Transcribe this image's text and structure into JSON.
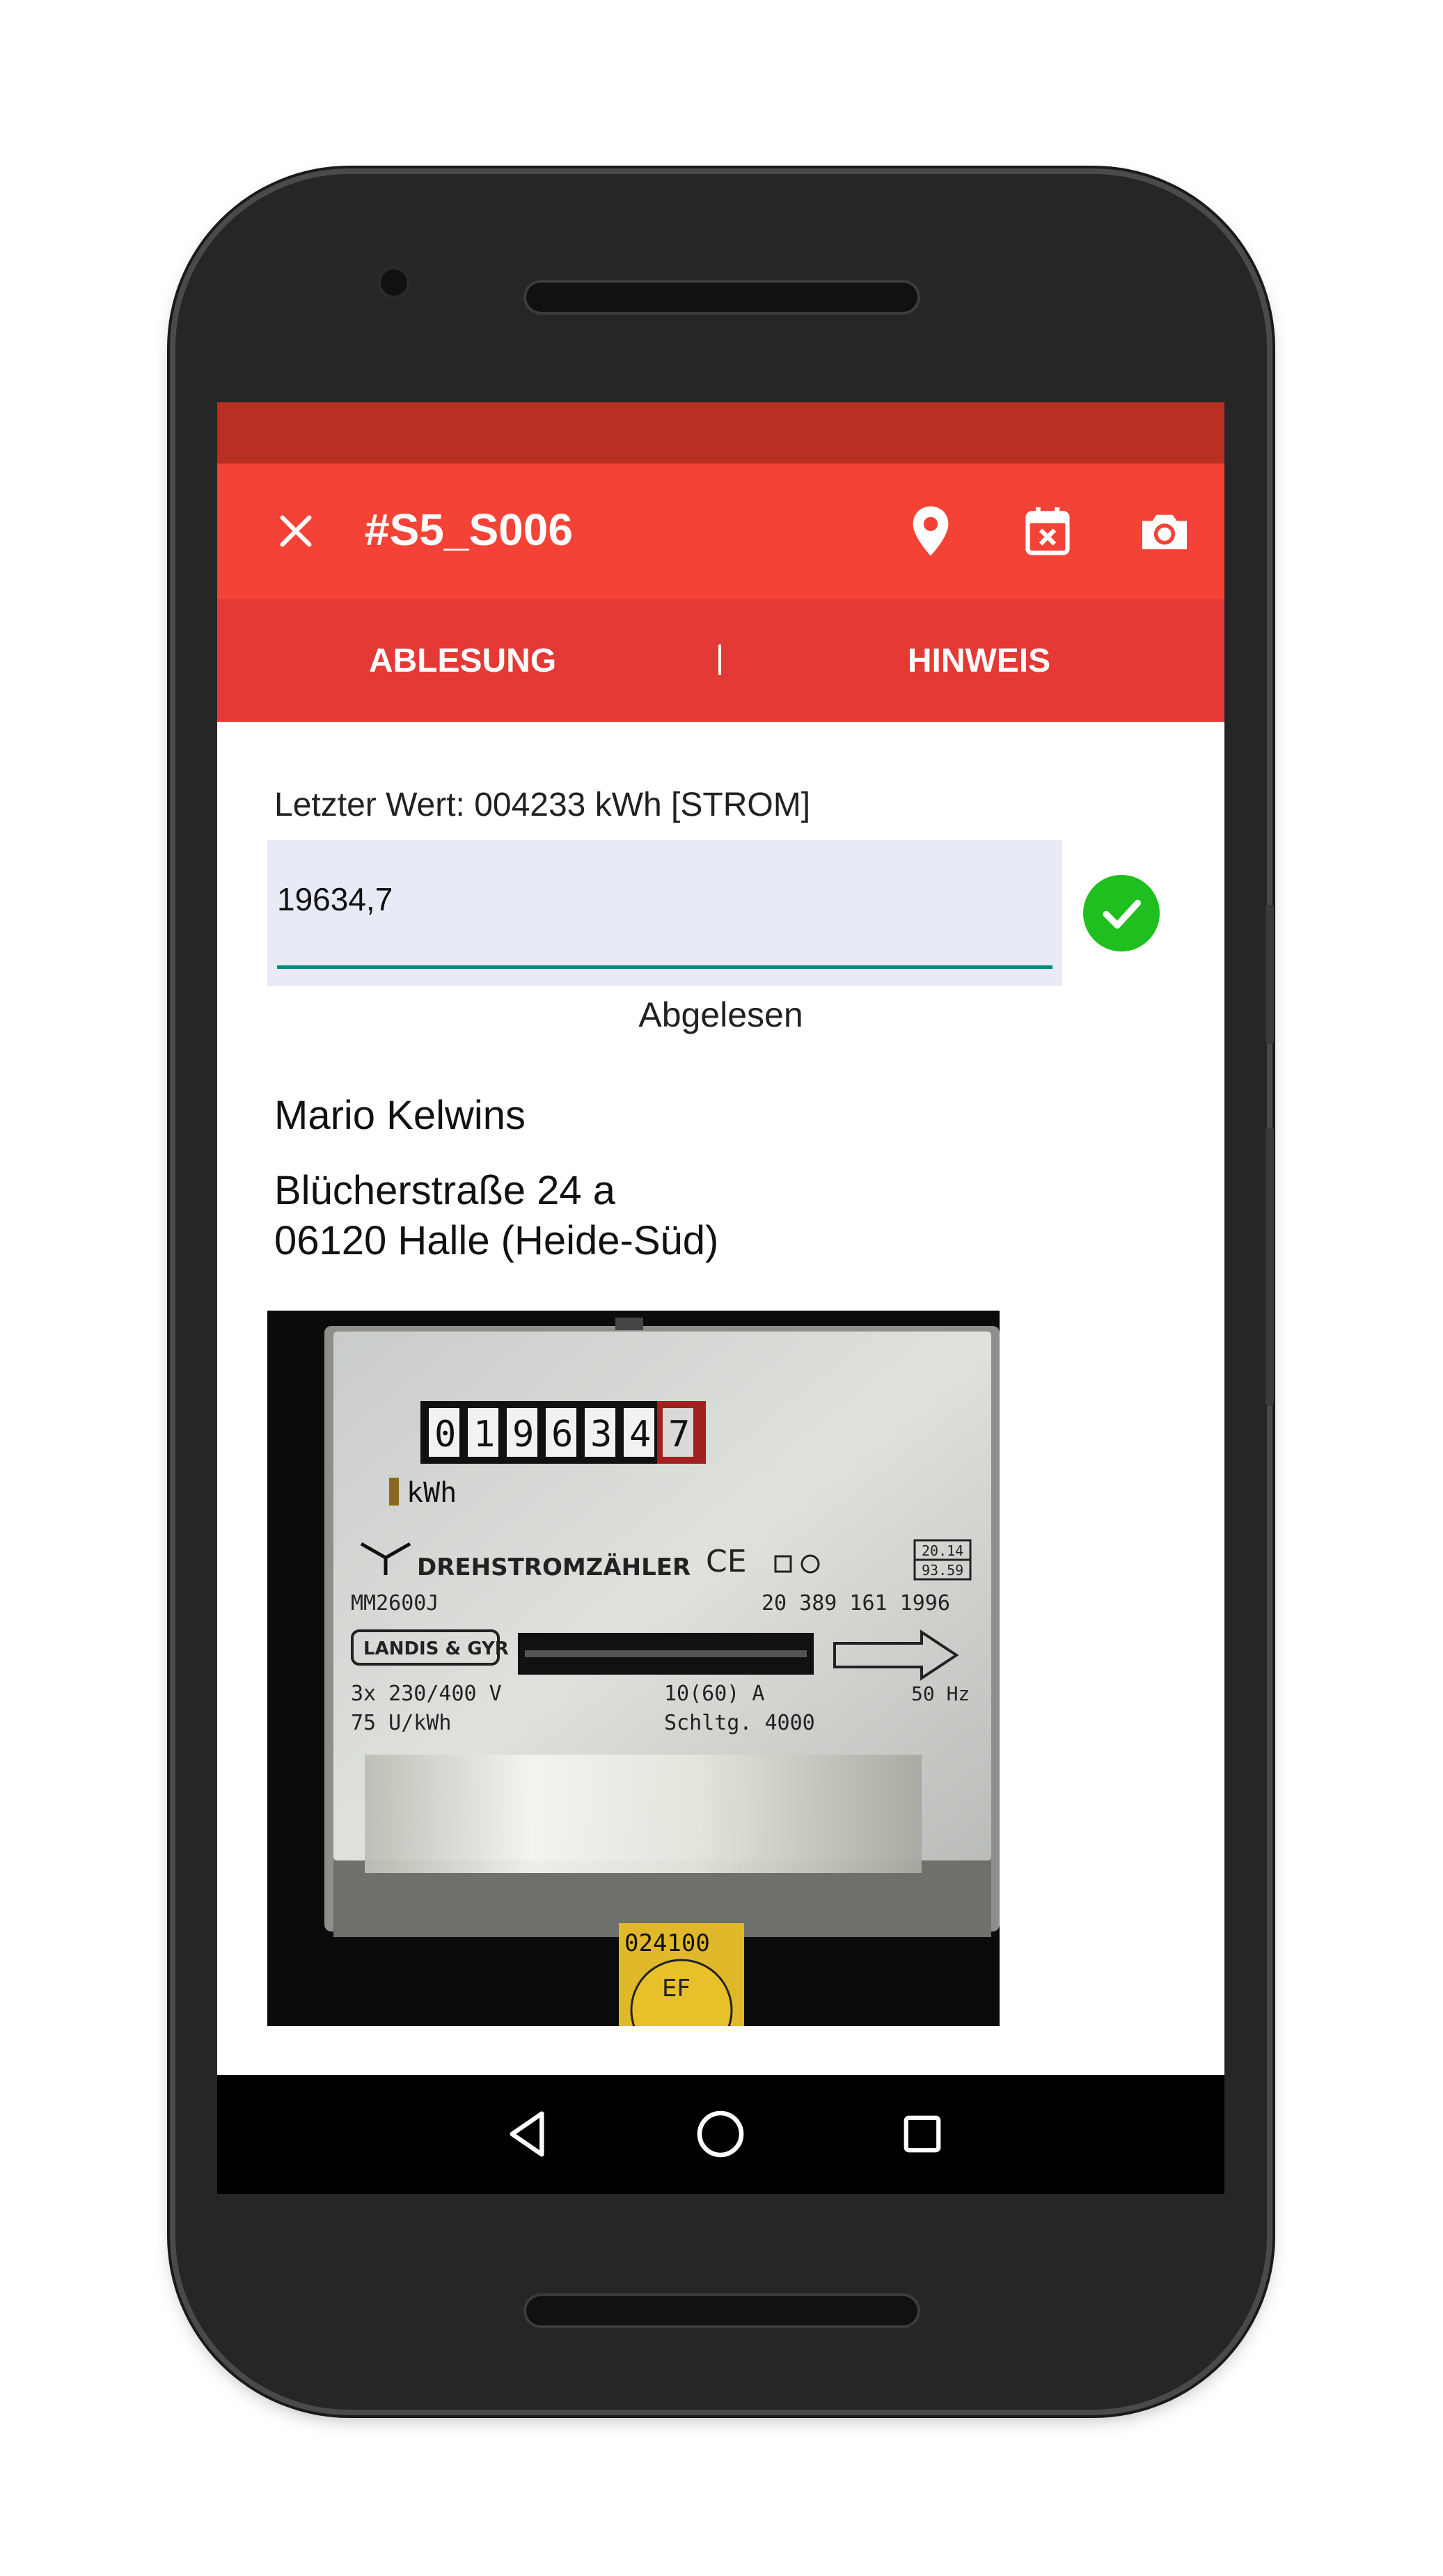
{
  "app": {
    "record_id": "#S5_S006",
    "actions": [
      "location-icon",
      "calendar-cancel-icon",
      "camera-icon"
    ]
  },
  "tabs": [
    {
      "label": "ABLESUNG"
    },
    {
      "label": "HINWEIS"
    }
  ],
  "tab_separator": "|",
  "reading": {
    "last_value": "Letzter Wert: 004233 kWh [STROM]",
    "input_value": "19634,7",
    "status": "Abgelesen"
  },
  "customer": {
    "name": "Mario Kelwins",
    "street": "Blücherstraße 24 a",
    "city": "06120 Halle (Heide-Süd)"
  },
  "meter_photo": {
    "counter": [
      "0",
      "1",
      "9",
      "6",
      "3",
      "4",
      "7"
    ],
    "unit": "kWh",
    "type_label": "DREHSTROMZÄHLER",
    "model": "MM2600J",
    "serial": "20 389 161 1996",
    "box_top": "20.14",
    "box_bottom": "93.59",
    "brand": "LANDIS & GYR",
    "voltage": "3x 230/400 V",
    "rpm": "75 U/kWh",
    "current": "10(60) A",
    "schaltung": "Schltg. 4000",
    "freq": "50 Hz",
    "seal_number": "024100",
    "seal_label": "EF"
  },
  "colors": {
    "statusbar": "#b83021",
    "toolbar": "#f44336",
    "tabs": "#e53935",
    "accent": "#00897b",
    "success": "#1fbf1f"
  }
}
